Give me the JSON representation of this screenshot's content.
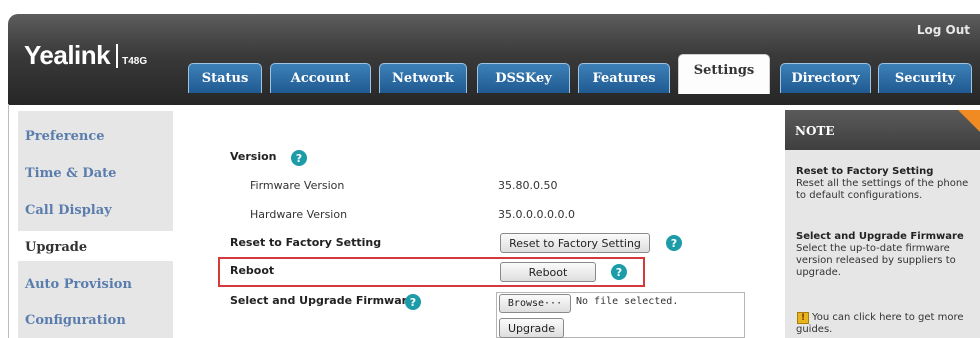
{
  "header": {
    "brand": "Yealink",
    "model": "T48G",
    "logout": "Log Out",
    "tabs": [
      {
        "label": "Status",
        "active": false
      },
      {
        "label": "Account",
        "active": false
      },
      {
        "label": "Network",
        "active": false
      },
      {
        "label": "DSSKey",
        "active": false
      },
      {
        "label": "Features",
        "active": false
      },
      {
        "label": "Settings",
        "active": true
      },
      {
        "label": "Directory",
        "active": false
      },
      {
        "label": "Security",
        "active": false
      }
    ]
  },
  "sidebar": {
    "items": [
      {
        "label": "Preference",
        "active": false
      },
      {
        "label": "Time & Date",
        "active": false
      },
      {
        "label": "Call Display",
        "active": false
      },
      {
        "label": "Upgrade",
        "active": true
      },
      {
        "label": "Auto Provision",
        "active": false
      },
      {
        "label": "Configuration",
        "active": false
      }
    ]
  },
  "main": {
    "version_label": "Version",
    "firmware_label": "Firmware Version",
    "firmware_value": "35.80.0.50",
    "hardware_label": "Hardware Version",
    "hardware_value": "35.0.0.0.0.0.0",
    "reset_label": "Reset to Factory Setting",
    "reset_button": "Reset to Factory Setting",
    "reboot_label": "Reboot",
    "reboot_button": "Reboot",
    "upgrade_label": "Select and Upgrade Firmware",
    "browse_button": "Browse···",
    "file_status": "No file selected.",
    "upgrade_button": "Upgrade",
    "help_glyph": "?"
  },
  "note": {
    "title": "NOTE",
    "reset_title": "Reset to Factory Setting",
    "reset_text": "Reset all the settings of the phone to default configurations.",
    "upgrade_title": "Select and Upgrade Firmware",
    "upgrade_text": "Select the up-to-date firmware version released by suppliers to upgrade.",
    "guide_text": "You can click here to get more guides."
  },
  "colors": {
    "tab_blue": "#1f5a91",
    "nav_link": "#5a7dad",
    "help_teal": "#1c9ba8",
    "highlight_red": "#d33a3a",
    "note_corner": "#f08a22"
  }
}
